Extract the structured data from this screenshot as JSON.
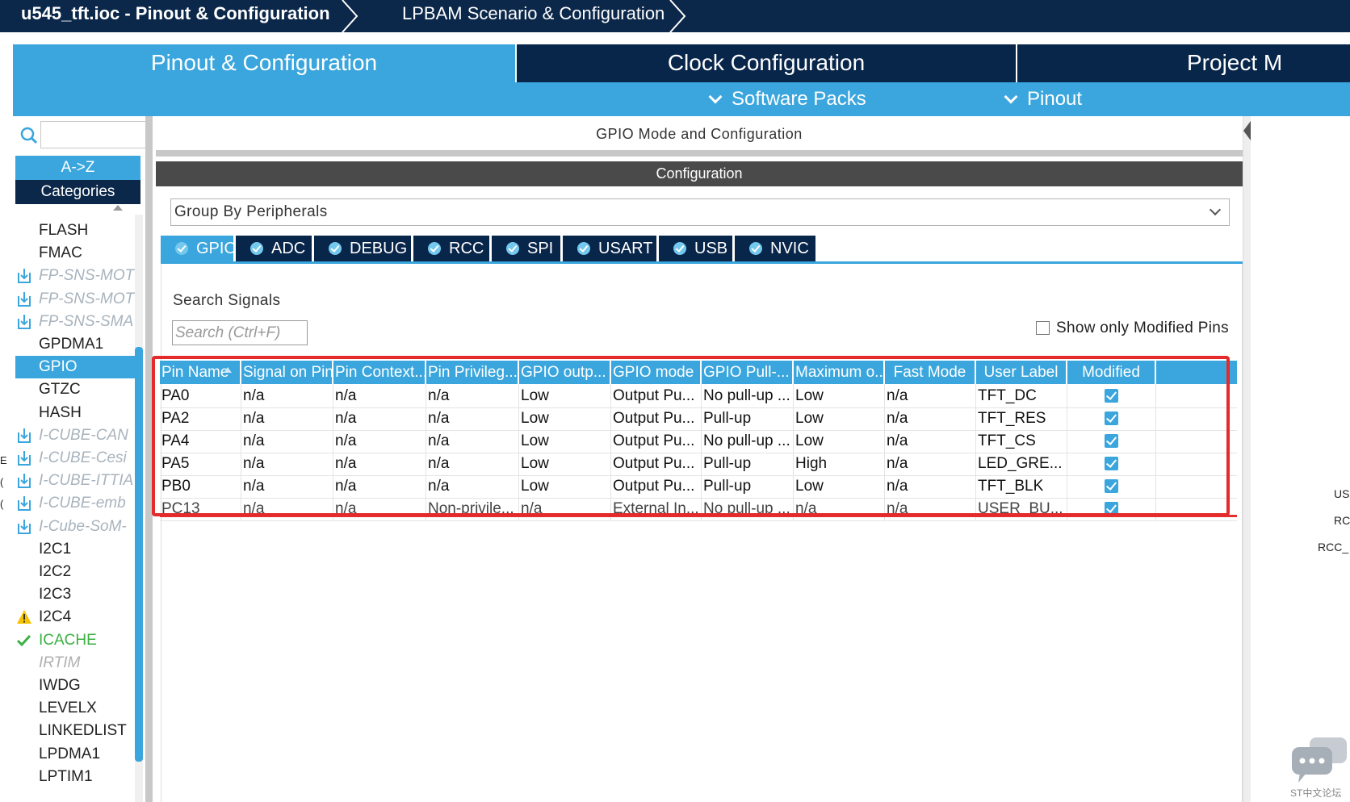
{
  "breadcrumb": {
    "project": "u545_tft.ioc - Pinout & Configuration",
    "scenario": "LPBAM Scenario & Configuration"
  },
  "main_tabs": [
    {
      "label": "Pinout & Configuration",
      "active": true
    },
    {
      "label": "Clock Configuration",
      "active": false
    },
    {
      "label": "Project M",
      "active": false
    }
  ],
  "sub_menu": {
    "software_packs": "Software Packs",
    "pinout": "Pinout"
  },
  "left_panel": {
    "sort_az": "A->Z",
    "categories": "Categories",
    "items": [
      {
        "label": "FLASH",
        "kind": "normal"
      },
      {
        "label": "FMAC",
        "kind": "normal"
      },
      {
        "label": "FP-SNS-MOT",
        "kind": "pack"
      },
      {
        "label": "FP-SNS-MOT",
        "kind": "pack"
      },
      {
        "label": "FP-SNS-SMA",
        "kind": "pack"
      },
      {
        "label": "GPDMA1",
        "kind": "normal"
      },
      {
        "label": "GPIO",
        "kind": "selected"
      },
      {
        "label": "GTZC",
        "kind": "normal"
      },
      {
        "label": "HASH",
        "kind": "normal"
      },
      {
        "label": "I-CUBE-CAN",
        "kind": "pack"
      },
      {
        "label": "I-CUBE-Cesi",
        "kind": "pack"
      },
      {
        "label": "I-CUBE-ITTIA",
        "kind": "pack"
      },
      {
        "label": "I-CUBE-emb",
        "kind": "pack"
      },
      {
        "label": "I-Cube-SoM-",
        "kind": "pack"
      },
      {
        "label": "I2C1",
        "kind": "normal"
      },
      {
        "label": "I2C2",
        "kind": "normal"
      },
      {
        "label": "I2C3",
        "kind": "normal"
      },
      {
        "label": "I2C4",
        "kind": "warning"
      },
      {
        "label": "ICACHE",
        "kind": "ok"
      },
      {
        "label": "IRTIM",
        "kind": "disabled"
      },
      {
        "label": "IWDG",
        "kind": "normal"
      },
      {
        "label": "LEVELX",
        "kind": "normal"
      },
      {
        "label": "LINKEDLIST",
        "kind": "normal"
      },
      {
        "label": "LPDMA1",
        "kind": "normal"
      },
      {
        "label": "LPTIM1",
        "kind": "normal"
      }
    ]
  },
  "center": {
    "header": "GPIO Mode and Configuration",
    "config_title": "Configuration",
    "group_by": "Group By Peripherals",
    "peripheral_tabs": [
      {
        "label": "GPIO",
        "active": true
      },
      {
        "label": "ADC",
        "active": false
      },
      {
        "label": "DEBUG",
        "active": false
      },
      {
        "label": "RCC",
        "active": false
      },
      {
        "label": "SPI",
        "active": false
      },
      {
        "label": "USART",
        "active": false
      },
      {
        "label": "USB",
        "active": false
      },
      {
        "label": "NVIC",
        "active": false
      }
    ],
    "search_label": "Search Signals",
    "search_placeholder": "Search (Ctrl+F)",
    "show_modified_label": "Show only Modified Pins",
    "show_modified_checked": false
  },
  "table": {
    "columns": [
      "Pin Name",
      "Signal on Pin",
      "Pin Context...",
      "Pin Privileg...",
      "GPIO outp...",
      "GPIO mode",
      "GPIO Pull-...",
      "Maximum o...",
      "Fast Mode",
      "User Label",
      "Modified"
    ],
    "rows": [
      {
        "cells": [
          "PA0",
          "n/a",
          "n/a",
          "n/a",
          "Low",
          "Output Pu...",
          "No pull-up ...",
          "Low",
          "n/a",
          "TFT_DC"
        ],
        "modified": true
      },
      {
        "cells": [
          "PA2",
          "n/a",
          "n/a",
          "n/a",
          "Low",
          "Output Pu...",
          "Pull-up",
          "Low",
          "n/a",
          "TFT_RES"
        ],
        "modified": true
      },
      {
        "cells": [
          "PA4",
          "n/a",
          "n/a",
          "n/a",
          "Low",
          "Output Pu...",
          "No pull-up ...",
          "Low",
          "n/a",
          "TFT_CS"
        ],
        "modified": true
      },
      {
        "cells": [
          "PA5",
          "n/a",
          "n/a",
          "n/a",
          "Low",
          "Output Pu...",
          "Pull-up",
          "High",
          "n/a",
          "LED_GRE..."
        ],
        "modified": true
      },
      {
        "cells": [
          "PB0",
          "n/a",
          "n/a",
          "n/a",
          "Low",
          "Output Pu...",
          "Pull-up",
          "Low",
          "n/a",
          "TFT_BLK"
        ],
        "modified": true
      },
      {
        "cells": [
          "PC13",
          "n/a",
          "n/a",
          "Non-privile...",
          "n/a",
          "External In...",
          "No pull-up ...",
          "n/a",
          "n/a",
          "USER_BU..."
        ],
        "modified": true
      }
    ]
  },
  "right_labels": [
    "USB",
    "RCC",
    "RCC_"
  ],
  "watermark": "ST中文论坛",
  "colors": {
    "accent": "#3aa6dd",
    "navy": "#0b2749",
    "highlight": "#e42a2a"
  }
}
